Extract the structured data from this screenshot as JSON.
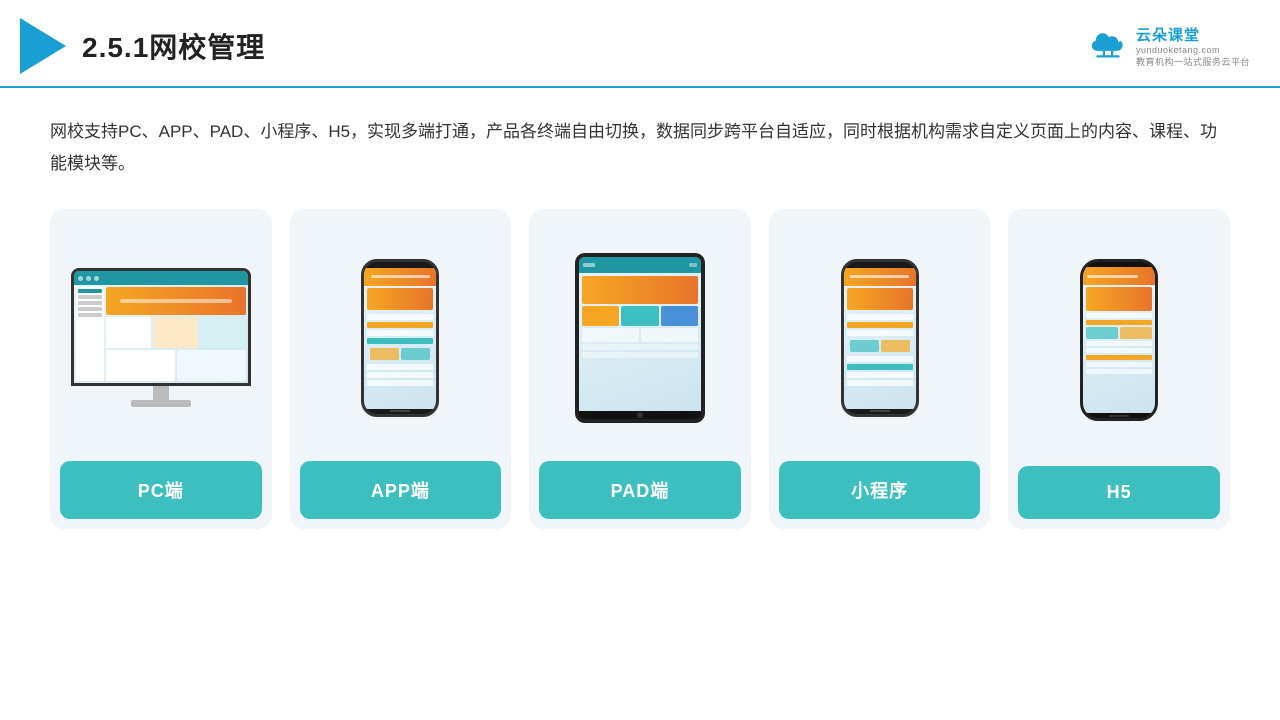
{
  "header": {
    "title": "2.5.1网校管理",
    "brand": {
      "name": "云朵课堂",
      "url": "yunduoketang.com",
      "tagline": "教育机构一站\n式服务云平台"
    }
  },
  "description": "网校支持PC、APP、PAD、小程序、H5，实现多端打通，产品各终端自由切换，数据同步跨平台自适应，同时根据机构需求自定义页面上的内容、课程、功能模块等。",
  "cards": [
    {
      "id": "pc",
      "label": "PC端"
    },
    {
      "id": "app",
      "label": "APP端"
    },
    {
      "id": "pad",
      "label": "PAD端"
    },
    {
      "id": "miniprogram",
      "label": "小程序"
    },
    {
      "id": "h5",
      "label": "H5"
    }
  ]
}
